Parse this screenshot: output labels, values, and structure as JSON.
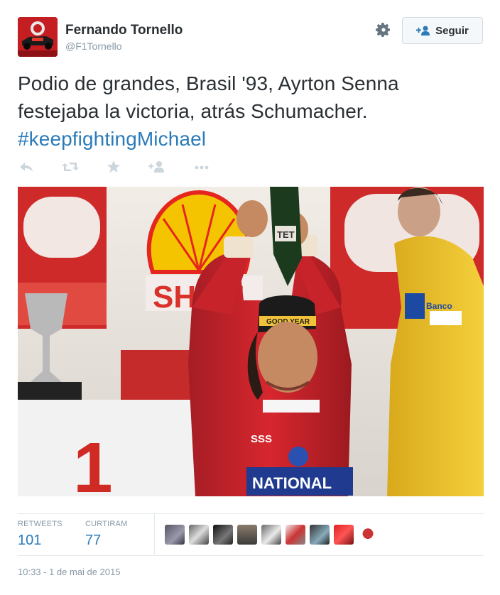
{
  "author": {
    "name": "Fernando Tornello",
    "handle": "@F1Tornello",
    "avatar_icon": "f1-car-avatar"
  },
  "follow_button": {
    "label": "Seguir",
    "icon": "follow-person-plus-icon"
  },
  "settings_icon": "gear-icon",
  "tweet": {
    "text_lines": [
      "Podio de grandes, Brasil '93, Ayrton Senna",
      "festejaba la victoria, atrás Schumacher."
    ],
    "hashtag": "#keepfightingMichael"
  },
  "actions": [
    {
      "name": "reply",
      "icon": "reply-icon"
    },
    {
      "name": "retweet",
      "icon": "retweet-icon"
    },
    {
      "name": "favorite",
      "icon": "star-icon"
    },
    {
      "name": "follow",
      "icon": "follow-icon"
    },
    {
      "name": "more",
      "icon": "ellipsis-icon"
    }
  ],
  "photo": {
    "subject": "tweet-photo",
    "text_bottle": "TET",
    "text_cap": "GOOD YEAR",
    "text_suit": "NATIONAL",
    "text_bank": "Banco",
    "text_sponsor": "SSS",
    "text_sign": "1"
  },
  "stats": {
    "retweets_label": "RETWEETS",
    "retweets_count": "101",
    "likes_label": "CURTIRAM",
    "likes_count": "77"
  },
  "likers_count_shown": 9,
  "timestamp": "10:33 - 1 de mai de 2015",
  "colors": {
    "link": "#2b7bb9",
    "text": "#292f33",
    "muted": "#8899a6",
    "action_icon": "#ccd6dd",
    "border": "#e1e8ed"
  }
}
